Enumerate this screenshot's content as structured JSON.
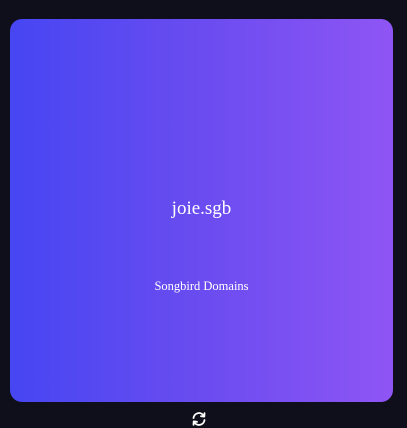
{
  "card": {
    "domain": "joie.sgb",
    "collection": "Songbird Domains",
    "gradient_start": "#4646f2",
    "gradient_end": "#8f55f4"
  },
  "controls": {
    "refresh_icon": "refresh-icon"
  },
  "colors": {
    "background": "#0e0f1a",
    "text": "#ffffff"
  }
}
